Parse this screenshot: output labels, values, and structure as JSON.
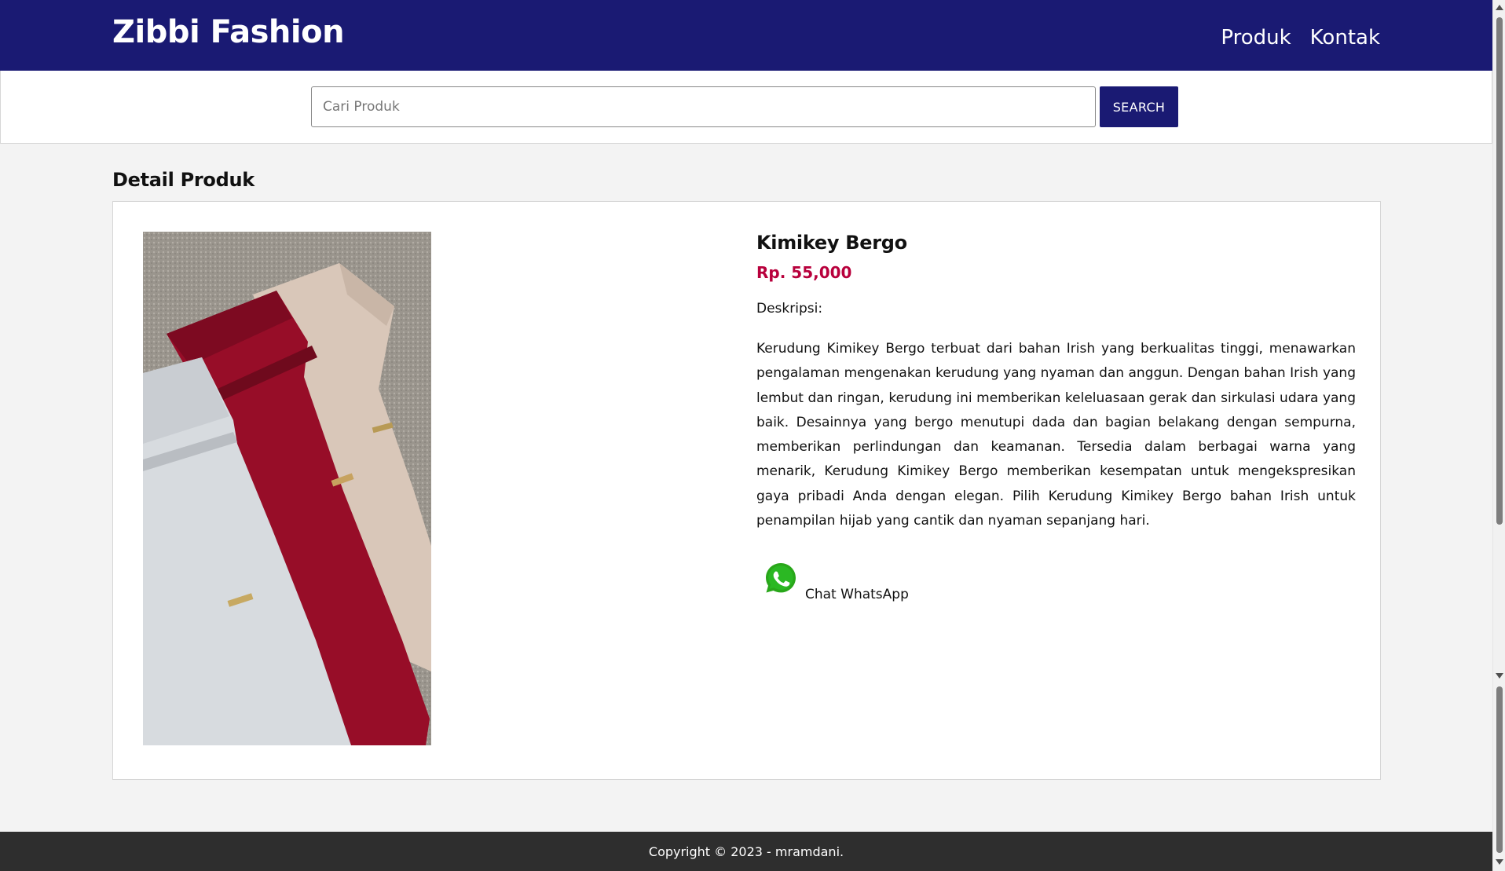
{
  "header": {
    "brand": "Zibbi Fashion",
    "nav": [
      "Produk",
      "Kontak"
    ]
  },
  "search": {
    "placeholder": "Cari Produk",
    "value": "",
    "button_label": "SEARCH"
  },
  "main": {
    "section_title": "Detail Produk",
    "product": {
      "name": "Kimikey Bergo",
      "price": "Rp. 55,000",
      "description_label": "Deskripsi:",
      "description": "Kerudung Kimikey Bergo terbuat dari bahan Irish yang berkualitas tinggi, menawarkan pengalaman mengenakan kerudung yang nyaman dan anggun. Dengan bahan Irish yang lembut dan ringan, kerudung ini memberikan keleluasaan gerak dan sirkulasi udara yang baik. Desainnya yang bergo menutupi dada dan bagian belakang dengan sempurna, memberikan perlindungan dan keamanan. Tersedia dalam berbagai warna yang menarik, Kerudung Kimikey Bergo memberikan kesempatan untuk mengekspresikan gaya pribadi Anda dengan elegan. Pilih Kerudung Kimikey Bergo bahan Irish untuk penampilan hijab yang cantik dan nyaman sepanjang hari.",
      "whatsapp_label": "Chat WhatsApp",
      "whatsapp_icon": "whatsapp-icon"
    }
  },
  "footer": {
    "copyright": "Copyright © 2023 - mramdani."
  },
  "colors": {
    "header_bg": "#1a1a73",
    "price": "#b8003c",
    "footer_bg": "#2e2e2e",
    "page_bg": "#f3f3f3"
  }
}
